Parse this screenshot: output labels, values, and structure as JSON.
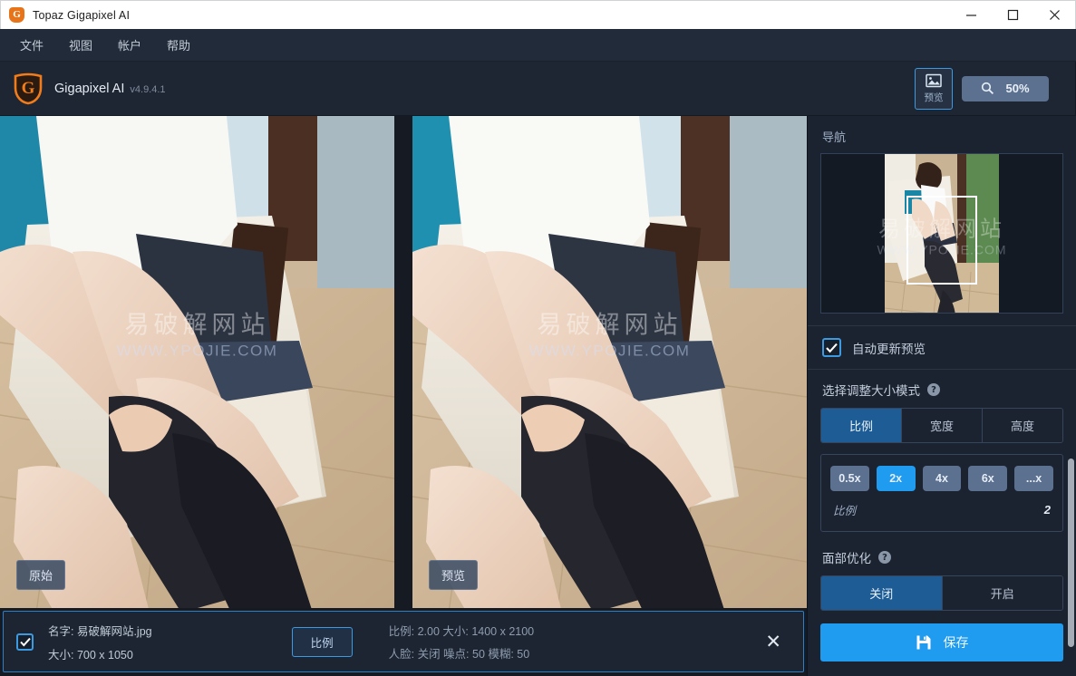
{
  "window": {
    "title": "Topaz Gigapixel AI",
    "logo_icon": "gigapixel-logo-icon",
    "minimize_label": "—",
    "maximize_label": "□",
    "close_label": "✕"
  },
  "menubar": {
    "items": [
      {
        "label": "文件"
      },
      {
        "label": "视图"
      },
      {
        "label": "帐户"
      },
      {
        "label": "帮助"
      }
    ]
  },
  "toolbar": {
    "brand_name": "Gigapixel AI",
    "brand_version": "v4.9.4.1",
    "brand_letter": "G",
    "preview_label": "预览",
    "preview_icon": "image-icon",
    "zoom_value": "50%",
    "zoom_icon": "magnifier-icon"
  },
  "viewer": {
    "original_badge": "原始",
    "preview_badge": "预览",
    "watermark_cn": "易破解网站",
    "watermark_url": "WWW.YPOJIE.COM"
  },
  "filebar": {
    "checked": true,
    "name_line": "名字: 易破解网站.jpg",
    "size_line": "大小: 700 x 1050",
    "ratio_button": "比例",
    "info_line1": "比例: 2.00  大小: 1400 x 2100",
    "info_line2": "人脸: 关闭  噪点: 50  模糊: 50",
    "close_icon": "close-icon",
    "close_label": "✕"
  },
  "sidebar": {
    "nav_title": "导航",
    "auto_preview": {
      "label": "自动更新预览",
      "checked": true,
      "check_glyph": "✓"
    },
    "resize_mode": {
      "title": "选择调整大小模式",
      "help_glyph": "?",
      "options": [
        {
          "label": "比例",
          "active": true
        },
        {
          "label": "宽度",
          "active": false
        },
        {
          "label": "高度",
          "active": false
        }
      ]
    },
    "scale": {
      "chips": [
        {
          "label": "0.5x",
          "active": false
        },
        {
          "label": "2x",
          "active": true
        },
        {
          "label": "4x",
          "active": false
        },
        {
          "label": "6x",
          "active": false
        },
        {
          "label": "...x",
          "active": false
        }
      ],
      "footer_key": "比例",
      "footer_value": "2"
    },
    "face": {
      "title": "面部优化",
      "help_glyph": "?",
      "options": [
        {
          "label": "关闭",
          "active": true
        },
        {
          "label": "开启",
          "active": false
        }
      ]
    },
    "save": {
      "label": "保存",
      "icon": "save-floppy-icon"
    }
  },
  "colors": {
    "accent_blue": "#1f9bf0",
    "brand_orange": "#f07c1b",
    "panel_bg": "#1b2230",
    "titlebar_bg": "#ffffff"
  }
}
